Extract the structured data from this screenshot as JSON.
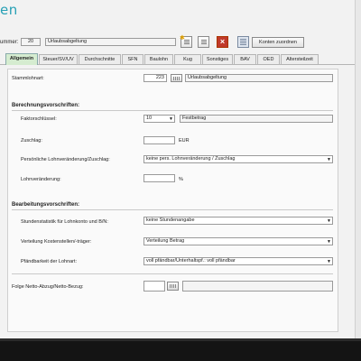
{
  "header": {
    "title": "en"
  },
  "top": {
    "number_label": "ummer:",
    "number_value": "20",
    "name_value": "Urlaubsabgeltung",
    "assign_button": "Konten zuordnen"
  },
  "tabs": [
    {
      "label": "Allgemein",
      "active": true
    },
    {
      "label": "Steuer/SV/UV"
    },
    {
      "label": "Durchschnitte"
    },
    {
      "label": "SFN"
    },
    {
      "label": "Baulohn"
    },
    {
      "label": "Kug"
    },
    {
      "label": "Sonstiges"
    },
    {
      "label": "BAV"
    },
    {
      "label": "OED"
    },
    {
      "label": "Altersteilzeit"
    }
  ],
  "form": {
    "stammlohnart_label": "Stammlohnart:",
    "stammlohnart_value": "223",
    "stammlohnart_name": "Urlaubsabgeltung",
    "section1": "Berechnungsvorschriften:",
    "faktor_label": "Faktorschlüssel:",
    "faktor_value": "10",
    "faktor_text": "Festbetrag",
    "zuschlag_label": "Zuschlag:",
    "zuschlag_unit": "EUR",
    "pers_label": "Persönliche Lohnveränderung/Zuschlag:",
    "pers_value": "keine pers. Lohnveränderung / Zuschlag",
    "lohnv_label": "Lohnveränderung:",
    "lohnv_unit": "%",
    "section2": "Bearbeitungsvorschriften:",
    "stunden_label": "Stundenstatistik für Lohnkonto und B/N:",
    "stunden_value": "keine Stundenangabe",
    "kosten_label": "Verteilung Kostenstellen/-träger:",
    "kosten_value": "Verteilung Betrag",
    "pfand_label": "Pfändbarkeit der Lohnart:",
    "pfand_value": "voll pfändbar/Unterhaltspf.: voll pfändbar",
    "folge_label": "Folge Netto-Abzug/Netto-Bezug:"
  },
  "colors": {
    "accent": "#27a0b5",
    "active_tab": "#d5ecd0"
  }
}
